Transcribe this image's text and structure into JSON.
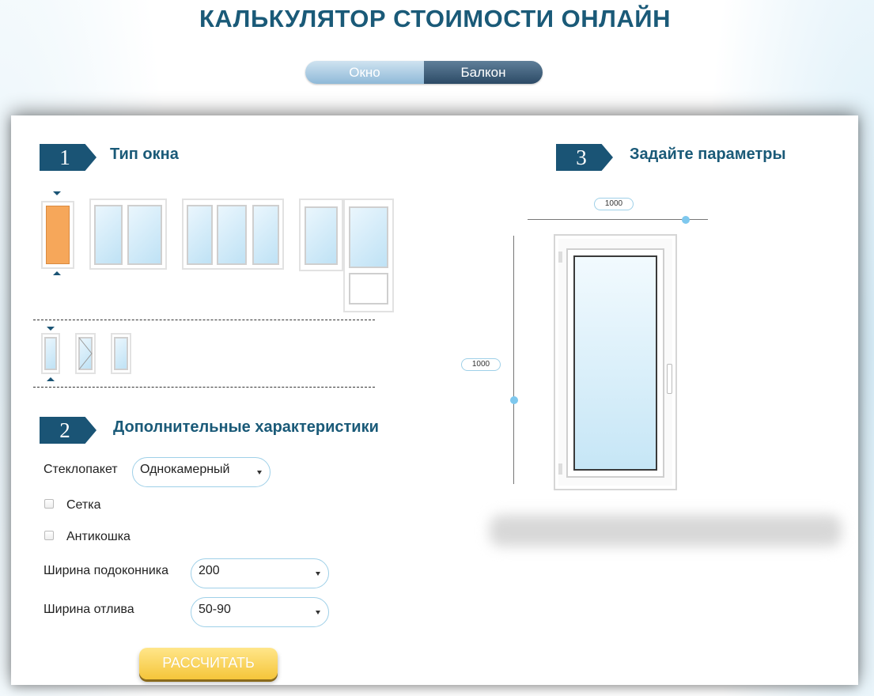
{
  "page": {
    "title": "КАЛЬКУЛЯТОР СТОИМОСТИ ОНЛАЙН"
  },
  "switcher": {
    "okno": "Окно",
    "balkon": "Балкон",
    "active": "balkon"
  },
  "step1": {
    "number": "1",
    "title": "Тип окна"
  },
  "step2": {
    "number": "2",
    "title": "Дополнительные характеристики",
    "glass_label": "Стеклопакет",
    "glass_value": "Однокамерный",
    "mesh_label": "Сетка",
    "anticat_label": "Антикошка",
    "sill_label": "Ширина подоконника",
    "sill_value": "200",
    "drip_label": "Ширина отлива",
    "drip_value": "50-90",
    "calc_button": "РАССЧИТАТЬ"
  },
  "step3": {
    "number": "3",
    "title": "Задайте параметры",
    "width_value": "1000",
    "height_value": "1000"
  },
  "colors": {
    "accent": "#1a5475",
    "title": "#1a5a78",
    "selected_window": "#f6a75a",
    "button": "#f5c53a"
  },
  "icons": [
    "window-single-icon",
    "window-double-icon",
    "window-triple-icon",
    "balcony-block-icon",
    "sash-fixed-icon",
    "sash-tilt-icon",
    "sash-turn-icon"
  ]
}
